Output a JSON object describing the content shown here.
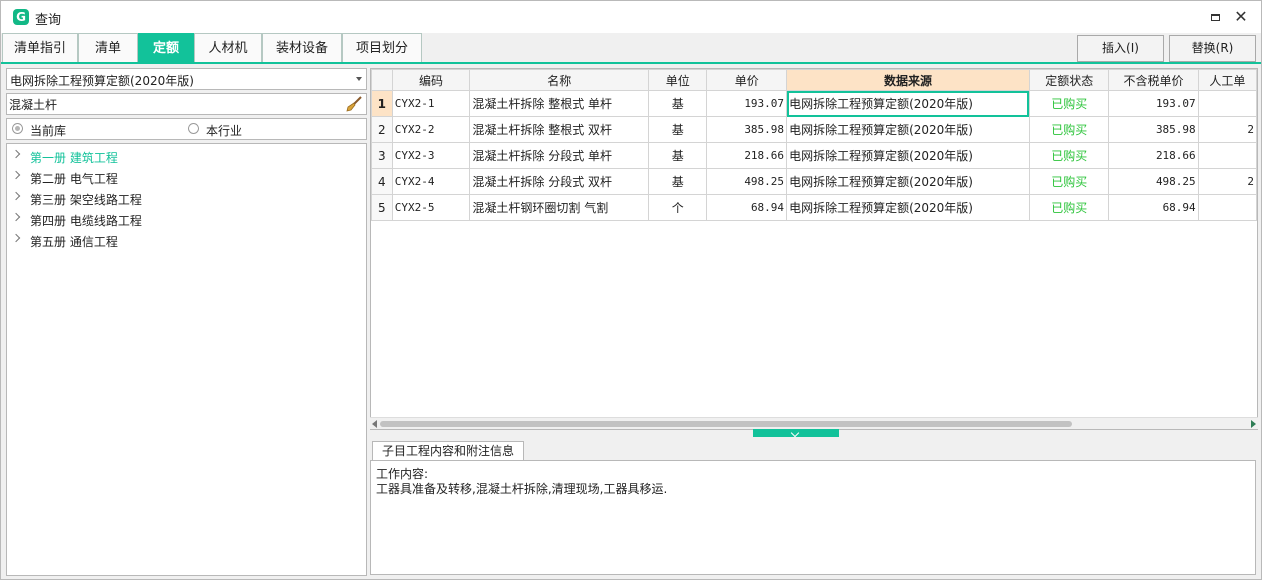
{
  "window": {
    "title": "查询",
    "logo": "G"
  },
  "tabs": [
    {
      "label": "清单指引"
    },
    {
      "label": "清单"
    },
    {
      "label": "定额",
      "active": true
    },
    {
      "label": "人材机"
    },
    {
      "label": "装材设备"
    },
    {
      "label": "项目划分"
    }
  ],
  "actions": {
    "insert_label": "插入(I)",
    "replace_label": "替换(R)"
  },
  "library": {
    "selected": "电网拆除工程预算定额(2020年版)"
  },
  "search": {
    "value": "混凝土杆",
    "icon": "broom-icon"
  },
  "scope": {
    "option1": "当前库",
    "option2": "本行业",
    "selected": "当前库"
  },
  "tree": [
    {
      "label": "第一册  建筑工程",
      "selected": true
    },
    {
      "label": "第二册  电气工程"
    },
    {
      "label": "第三册  架空线路工程"
    },
    {
      "label": "第四册  电缆线路工程"
    },
    {
      "label": "第五册  通信工程"
    }
  ],
  "grid": {
    "columns": [
      "编码",
      "名称",
      "单位",
      "单价",
      "数据来源",
      "定额状态",
      "不含税单价",
      "人工单"
    ],
    "rows": [
      {
        "num": "1",
        "code": "CYX2-1",
        "name": "混凝土杆拆除  整根式  单杆",
        "unit": "基",
        "price": "193.07",
        "source": "电网拆除工程预算定额(2020年版)",
        "status": "已购买",
        "notax": "193.07",
        "labor": ""
      },
      {
        "num": "2",
        "code": "CYX2-2",
        "name": "混凝土杆拆除  整根式  双杆",
        "unit": "基",
        "price": "385.98",
        "source": "电网拆除工程预算定额(2020年版)",
        "status": "已购买",
        "notax": "385.98",
        "labor": "2"
      },
      {
        "num": "3",
        "code": "CYX2-3",
        "name": "混凝土杆拆除  分段式  单杆",
        "unit": "基",
        "price": "218.66",
        "source": "电网拆除工程预算定额(2020年版)",
        "status": "已购买",
        "notax": "218.66",
        "labor": ""
      },
      {
        "num": "4",
        "code": "CYX2-4",
        "name": "混凝土杆拆除  分段式  双杆",
        "unit": "基",
        "price": "498.25",
        "source": "电网拆除工程预算定额(2020年版)",
        "status": "已购买",
        "notax": "498.25",
        "labor": "2"
      },
      {
        "num": "5",
        "code": "CYX2-5",
        "name": "混凝土杆钢环圈切割  气割",
        "unit": "个",
        "price": "68.94",
        "source": "电网拆除工程预算定额(2020年版)",
        "status": "已购买",
        "notax": "68.94",
        "labor": ""
      }
    ]
  },
  "info": {
    "tab_label": "子目工程内容和附注信息",
    "line1": "工作内容:",
    "line2": "工器具准备及转移,混凝土杆拆除,清理现场,工器具移运."
  },
  "colors": {
    "accent": "#12c29a",
    "header_highlight": "#fde3c6",
    "status_green": "#2dc43b"
  }
}
